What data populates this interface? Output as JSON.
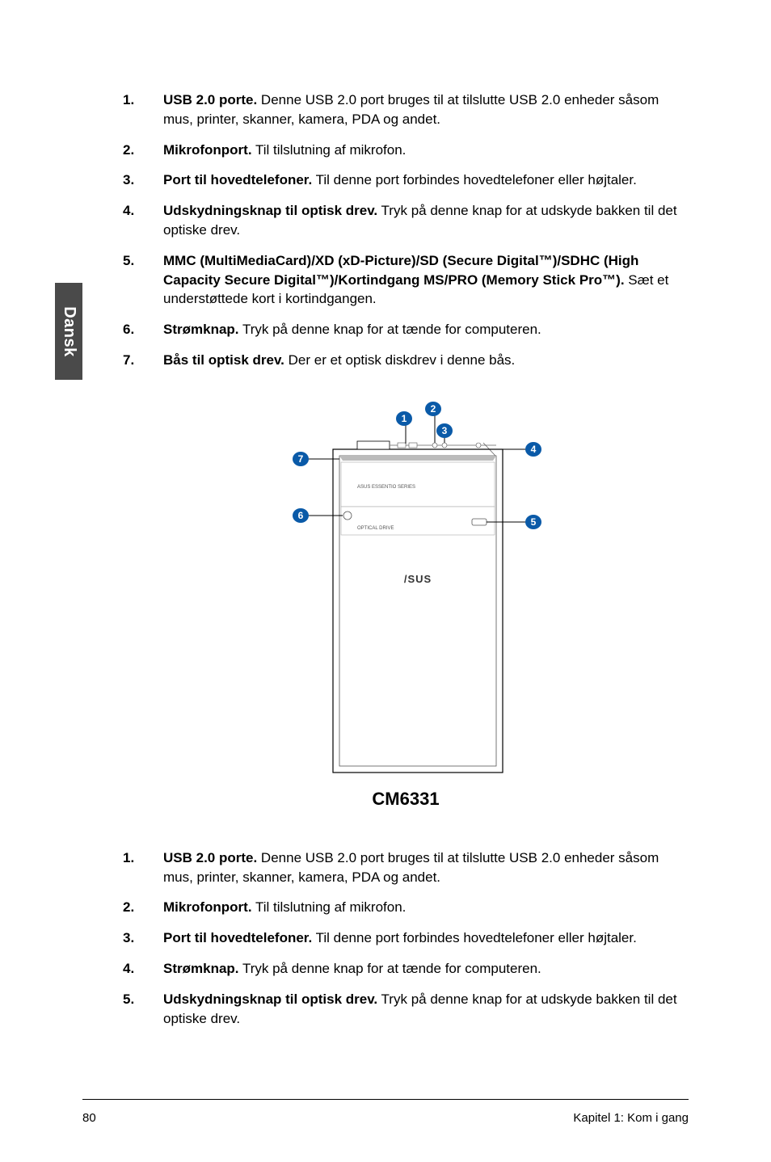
{
  "sidetab": {
    "label": "Dansk"
  },
  "list1": [
    {
      "num": "1.",
      "bold": "USB 2.0 porte.",
      "text": " Denne USB 2.0 port bruges til at tilslutte USB 2.0 enheder såsom mus, printer, skanner, kamera, PDA og andet."
    },
    {
      "num": "2.",
      "bold": "Mikrofonport.",
      "text": " Til tilslutning af mikrofon."
    },
    {
      "num": "3.",
      "bold": "Port til hovedtelefoner.",
      "text": " Til denne port forbindes hovedtelefoner eller højtaler."
    },
    {
      "num": "4.",
      "bold": "Udskydningsknap til optisk drev.",
      "text": " Tryk på denne knap for at udskyde bakken til det optiske drev."
    },
    {
      "num": "5.",
      "bold": "MMC (MultiMediaCard)/XD (xD-Picture)/SD (Secure Digital™)/SDHC (High Capacity Secure Digital™)/Kortindgang MS/PRO (Memory Stick Pro™).",
      "text": " Sæt et understøttede kort i kortindgangen."
    },
    {
      "num": "6.",
      "bold": "Strømknap.",
      "text": " Tryk på denne knap for at tænde for computeren."
    },
    {
      "num": "7.",
      "bold": "Bås til optisk drev.",
      "text": " Der er et optisk diskdrev i denne bås."
    }
  ],
  "diagram": {
    "caption": "CM6331",
    "callouts": [
      "1",
      "2",
      "3",
      "4",
      "5",
      "6",
      "7"
    ],
    "small_text_top": "ASUS ESSENTIO SERIES",
    "small_text_mid": "OPTICAL DRIVE",
    "logo": "/SUS"
  },
  "list2": [
    {
      "num": "1.",
      "bold": "USB 2.0 porte.",
      "text": " Denne USB 2.0 port bruges til at tilslutte USB 2.0 enheder såsom mus, printer, skanner, kamera, PDA og andet."
    },
    {
      "num": "2.",
      "bold": "Mikrofonport.",
      "text": " Til tilslutning af mikrofon."
    },
    {
      "num": "3.",
      "bold": "Port til hovedtelefoner.",
      "text": " Til denne port forbindes hovedtelefoner eller højtaler."
    },
    {
      "num": "4.",
      "bold": "Strømknap.",
      "text": " Tryk på denne knap for at tænde for computeren."
    },
    {
      "num": "5.",
      "bold": "Udskydningsknap til optisk drev.",
      "text": " Tryk på denne knap for at udskyde bakken til det optiske drev."
    }
  ],
  "footer": {
    "left": "80",
    "right": "Kapitel 1: Kom i gang"
  }
}
